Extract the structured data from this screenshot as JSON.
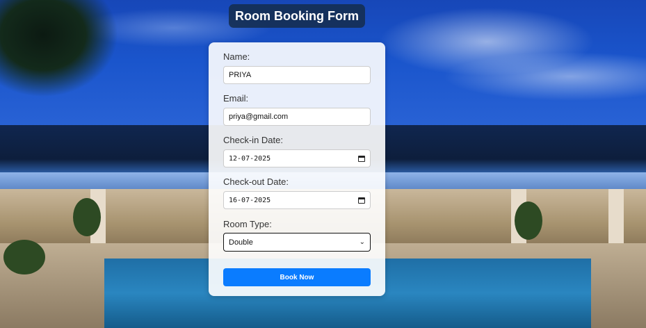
{
  "page": {
    "title": "Room Booking Form"
  },
  "form": {
    "name": {
      "label": "Name:",
      "value": "PRIYA"
    },
    "email": {
      "label": "Email:",
      "value": "priya@gmail.com"
    },
    "checkin": {
      "label": "Check-in Date:",
      "value": "12-07-2025"
    },
    "checkout": {
      "label": "Check-out Date:",
      "value": "16-07-2025"
    },
    "room_type": {
      "label": "Room Type:",
      "value": "Double"
    },
    "submit_label": "Book Now"
  },
  "colors": {
    "accent": "#0a7cff",
    "title_bg": "#142d50"
  },
  "icons": {
    "date": "calendar-icon",
    "select": "chevron-down-icon"
  }
}
